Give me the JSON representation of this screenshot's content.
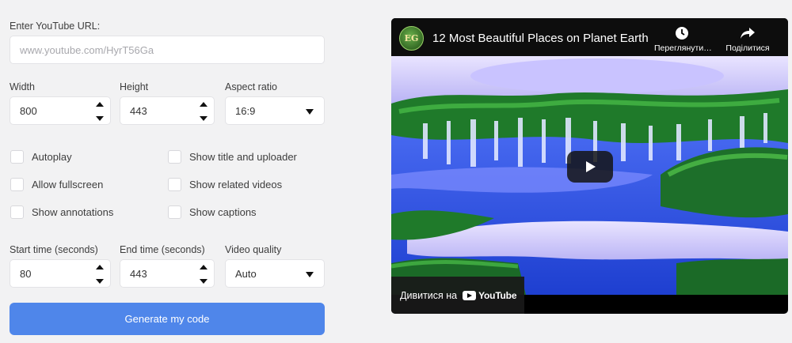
{
  "form": {
    "url_label": "Enter YouTube URL:",
    "url_placeholder": "www.youtube.com/HyrT56Ga",
    "width_label": "Width",
    "width_value": "800",
    "height_label": "Height",
    "height_value": "443",
    "aspect_label": "Aspect ratio",
    "aspect_value": "16:9",
    "checkboxes": {
      "autoplay": "Autoplay",
      "fullscreen": "Allow fullscreen",
      "annotations": "Show annotations",
      "title_uploader": "Show title and uploader",
      "related": "Show related videos",
      "captions": "Show captions"
    },
    "start_label": "Start time (seconds)",
    "start_value": "80",
    "end_label": "End time (seconds)",
    "end_value": "443",
    "quality_label": "Video quality",
    "quality_value": "Auto",
    "generate_label": "Generate my code"
  },
  "video": {
    "channel_logo_text": "EG",
    "title": "12 Most Beautiful Places on Planet Earth",
    "watch_later_label": "Переглянути…",
    "share_label": "Поділитися",
    "watch_on_label": "Дивитися на",
    "youtube_label": "YouTube"
  },
  "colors": {
    "accent": "#4f86ea",
    "background": "#f2f2f3"
  }
}
